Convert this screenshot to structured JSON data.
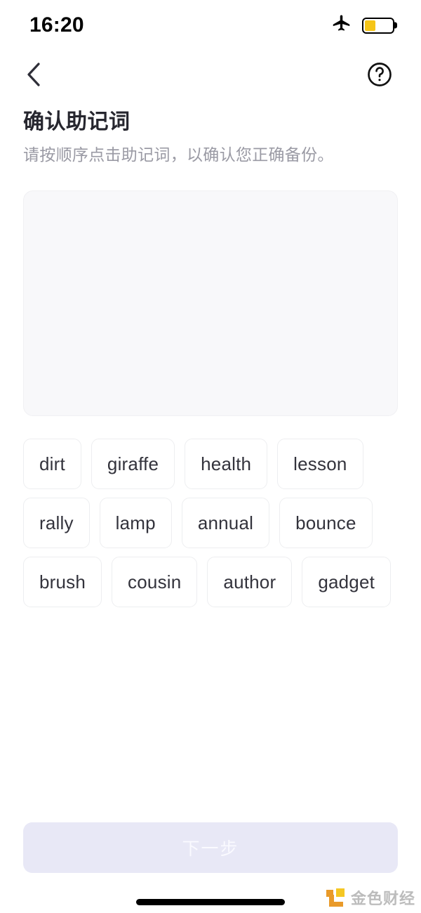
{
  "status_bar": {
    "time": "16:20",
    "airplane_icon": "airplane-mode-icon",
    "battery_icon": "battery-low-power-icon",
    "battery_level_percent": 40,
    "battery_color": "#f5c518"
  },
  "nav": {
    "back_icon": "chevron-left-icon",
    "help_icon": "question-mark-circle-icon"
  },
  "header": {
    "title": "确认助记词",
    "subtitle": "请按顺序点击助记词，以确认您正确备份。"
  },
  "answer_area": {
    "selected_words": [],
    "background_color": "#f8f8fa"
  },
  "word_pool": {
    "words": [
      "dirt",
      "giraffe",
      "health",
      "lesson",
      "rally",
      "lamp",
      "annual",
      "bounce",
      "brush",
      "cousin",
      "author",
      "gadget"
    ]
  },
  "footer": {
    "next_label": "下一步",
    "next_enabled": false,
    "next_background": "#e8e8f6"
  },
  "watermark": {
    "text": "金色财经",
    "logo_colors": [
      "#e8951f",
      "#f5c518"
    ]
  }
}
